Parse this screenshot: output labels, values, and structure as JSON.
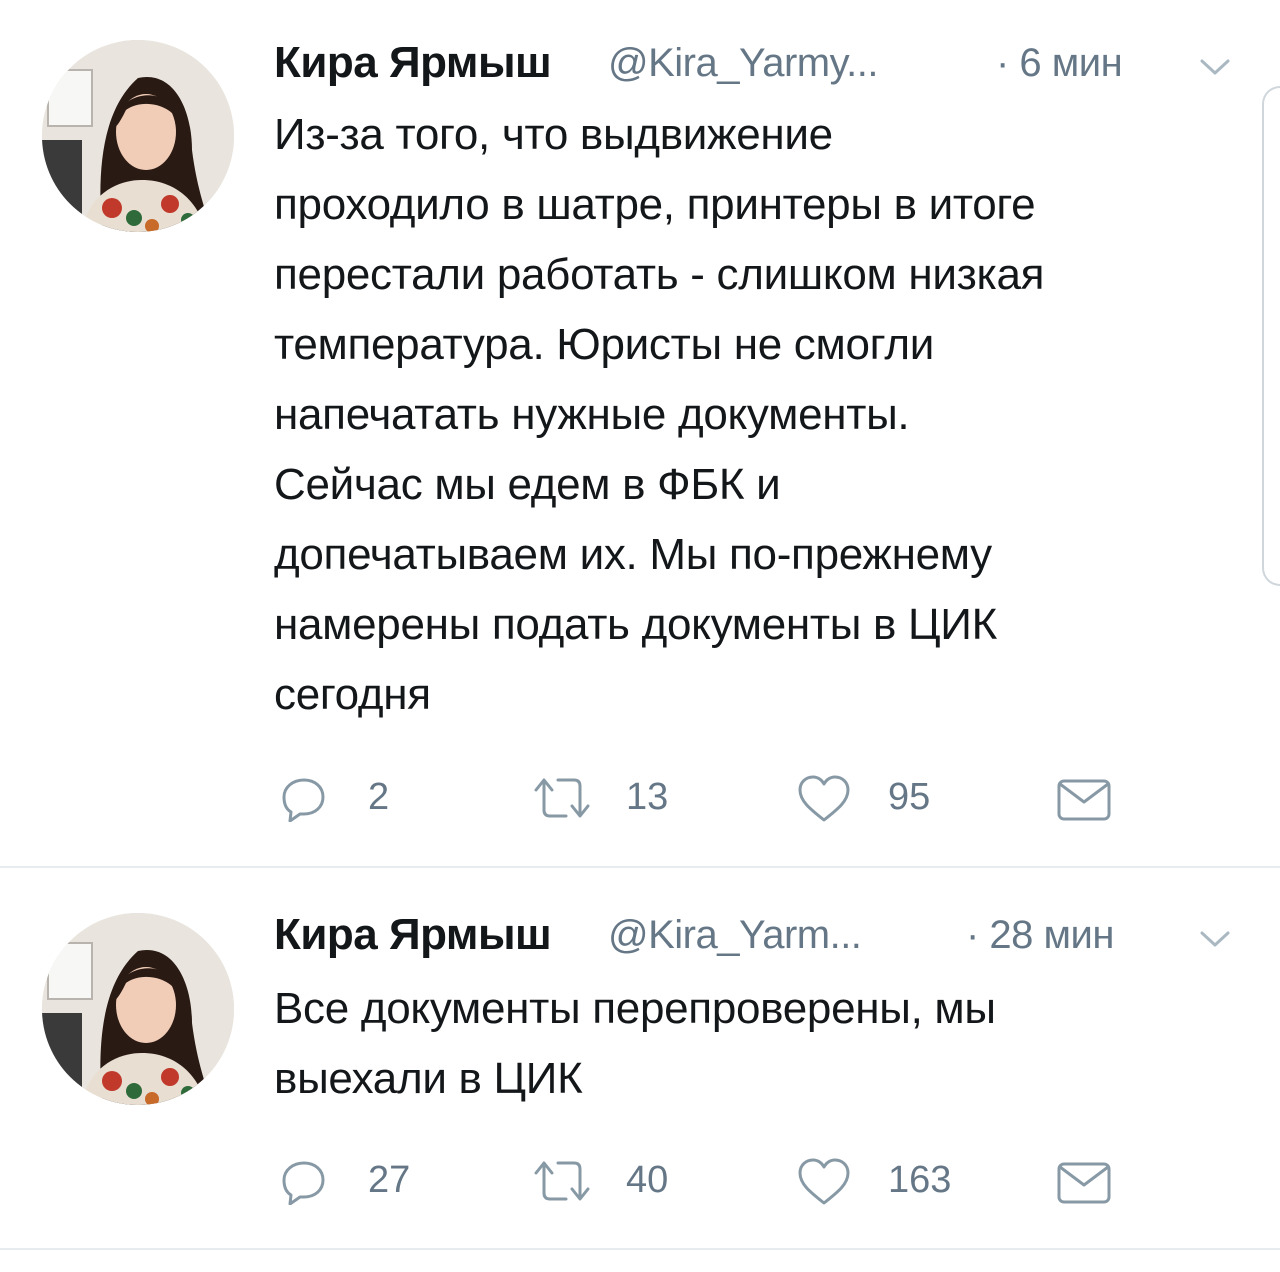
{
  "tweets": [
    {
      "author_name": "Кира Ярмыш",
      "handle": "@Kira_Yarmy...",
      "time": "· 6 мин",
      "text_lines": [
        "Из-за того, что выдвижение",
        "проходило в шатре, принтеры в итоге",
        "перестали работать - слишком низкая",
        "температура. Юристы не смогли",
        "напечатать нужные документы.",
        "Сейчас мы едем в ФБК и",
        "допечатываем их. Мы по-прежнему",
        "намерены подать документы в ЦИК",
        "сегодня"
      ],
      "replies": "2",
      "retweets": "13",
      "likes": "95"
    },
    {
      "author_name": "Кира Ярмыш",
      "handle": "@Kira_Yarm...",
      "time": "· 28 мин",
      "text_lines": [
        "Все документы перепроверены, мы",
        "выехали в ЦИК"
      ],
      "replies": "27",
      "retweets": "40",
      "likes": "163"
    }
  ],
  "icons": {
    "reply": "reply-icon",
    "retweet": "retweet-icon",
    "like": "heart-icon",
    "dm": "envelope-icon",
    "menu": "chevron-down-icon"
  },
  "colors": {
    "text": "#14171a",
    "secondary": "#657786",
    "divider": "#e6ecf0"
  }
}
